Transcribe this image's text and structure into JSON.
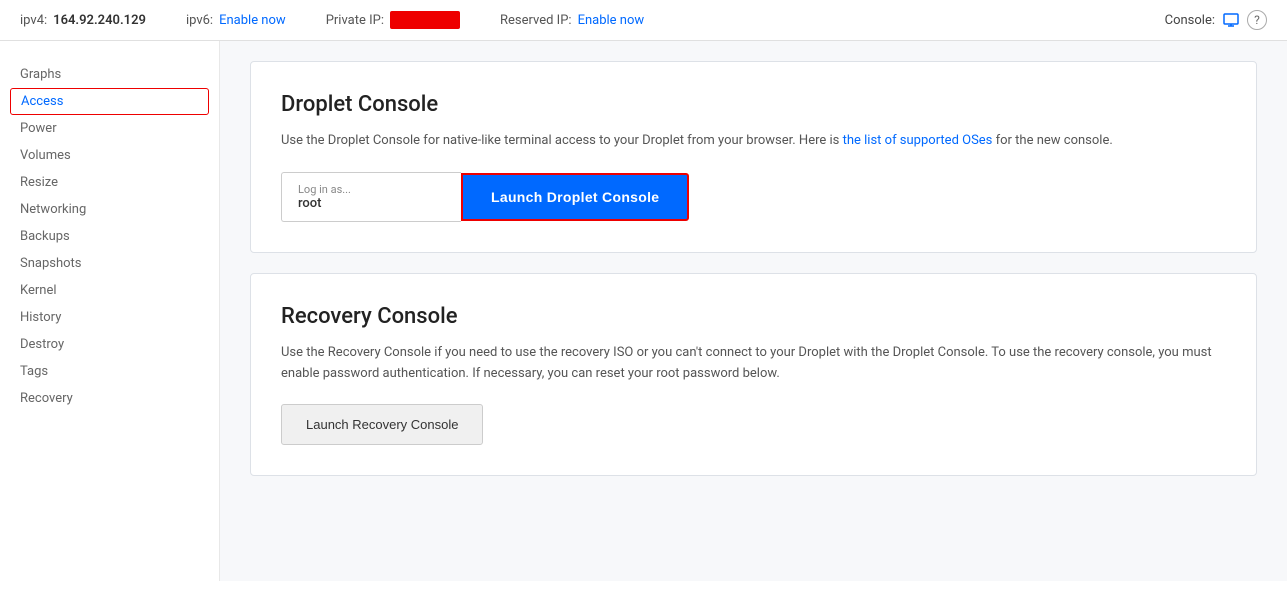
{
  "topbar": {
    "ipv4_label": "ipv4:",
    "ipv4_value": "164.92.240.129",
    "ipv6_label": "ipv6:",
    "ipv6_enable": "Enable now",
    "private_ip_label": "Private IP:",
    "reserved_ip_label": "Reserved IP:",
    "reserved_ip_enable": "Enable now",
    "console_label": "Console:"
  },
  "sidebar": {
    "items": [
      {
        "id": "graphs",
        "label": "Graphs",
        "active": false
      },
      {
        "id": "access",
        "label": "Access",
        "active": true
      },
      {
        "id": "power",
        "label": "Power",
        "active": false
      },
      {
        "id": "volumes",
        "label": "Volumes",
        "active": false
      },
      {
        "id": "resize",
        "label": "Resize",
        "active": false
      },
      {
        "id": "networking",
        "label": "Networking",
        "active": false
      },
      {
        "id": "backups",
        "label": "Backups",
        "active": false
      },
      {
        "id": "snapshots",
        "label": "Snapshots",
        "active": false
      },
      {
        "id": "kernel",
        "label": "Kernel",
        "active": false
      },
      {
        "id": "history",
        "label": "History",
        "active": false
      },
      {
        "id": "destroy",
        "label": "Destroy",
        "active": false
      },
      {
        "id": "tags",
        "label": "Tags",
        "active": false
      },
      {
        "id": "recovery",
        "label": "Recovery",
        "active": false
      }
    ]
  },
  "droplet_console": {
    "title": "Droplet Console",
    "description_start": "Use the Droplet Console for native-like terminal access to your Droplet from your browser. Here is ",
    "link_text": "the list of supported OSes",
    "description_end": " for the new console.",
    "login_label": "Log in as...",
    "login_value": "root",
    "launch_button": "Launch Droplet Console"
  },
  "recovery_console": {
    "title": "Recovery Console",
    "description_start": "Use the Recovery Console if you need to use the recovery ISO or you can't connect to your Droplet with the Droplet Console. To use the recovery console, you must enable password authentication. If necessary, you can reset your root password below.",
    "launch_button": "Launch Recovery Console"
  }
}
